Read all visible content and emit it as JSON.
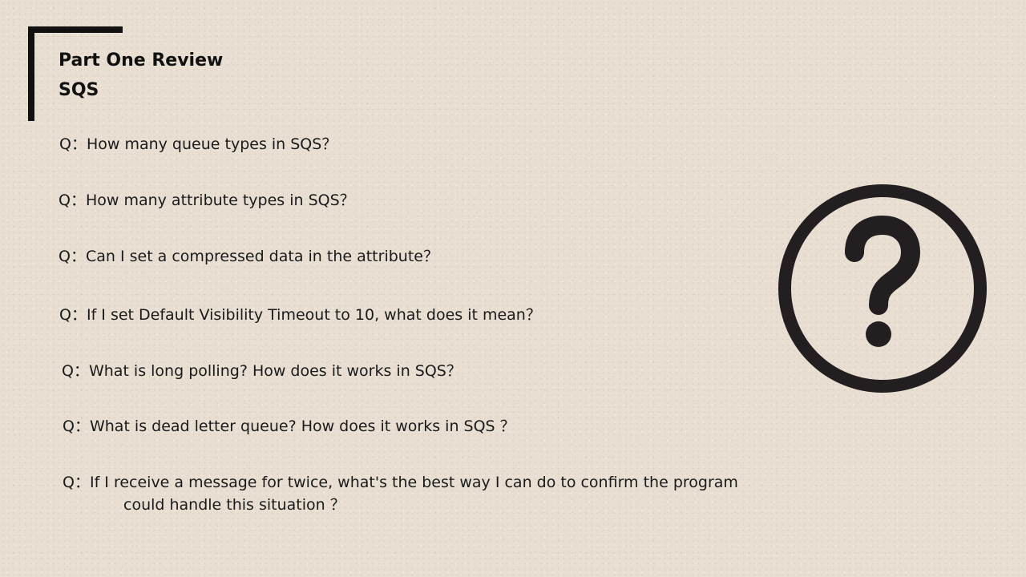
{
  "slide": {
    "title": "Part One Review",
    "subtitle": "SQS"
  },
  "questions": [
    {
      "prefix": "Q：",
      "text": "How many queue types in SQS？"
    },
    {
      "prefix": "Q：",
      "text": "How many attribute types in SQS？"
    },
    {
      "prefix": "Q：",
      "text": "Can I set a compressed data in the attribute？"
    },
    {
      "prefix": "Q：",
      "text": "If I set Default Visibility Timeout to 10, what does it mean？"
    },
    {
      "prefix": "Q：",
      "text": "What is long polling? How does it works in SQS？"
    },
    {
      "prefix": "Q： ",
      "text": "What is dead letter queue? How does it works in SQS ？"
    },
    {
      "prefix": "Q： ",
      "text": "If I receive a message for twice, what's the best way I can do to confirm the program",
      "continuation": "could handle this situation ？"
    }
  ],
  "icons": {
    "main": "question-mark-circle-icon"
  },
  "colors": {
    "background": "#e8dfd2",
    "ink": "#111111",
    "icon": "#231f20"
  }
}
